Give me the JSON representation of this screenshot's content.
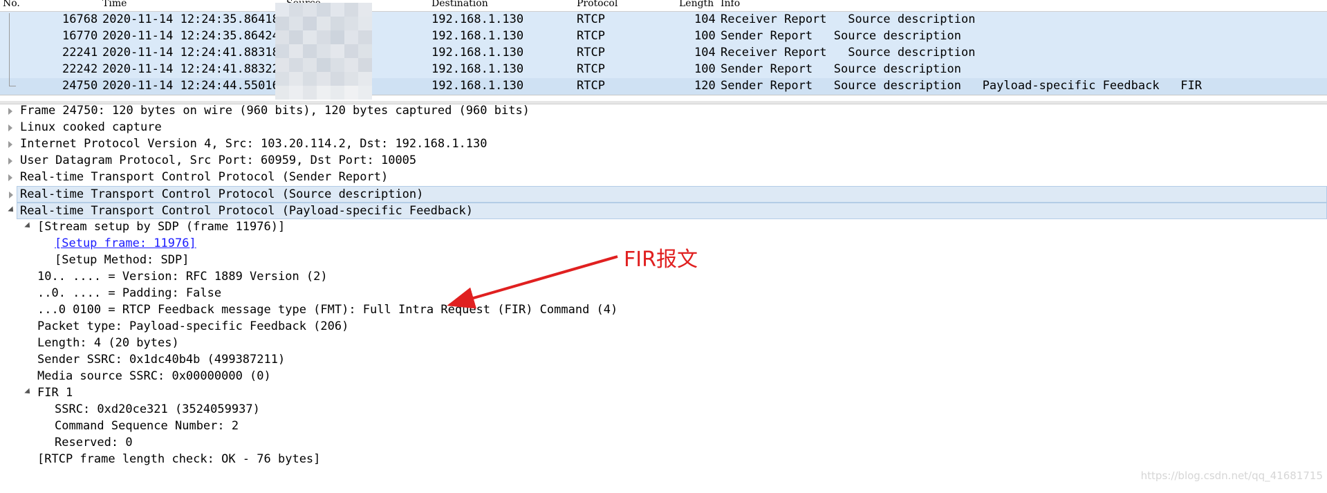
{
  "packet_list": {
    "columns": {
      "no": "No.",
      "time": "Time",
      "source": "Source",
      "destination": "Destination",
      "protocol": "Protocol",
      "length": "Length",
      "info": "Info"
    },
    "rows": [
      {
        "no": "16768",
        "time": "2020-11-14 12:24:35.86418",
        "destination": "192.168.1.130",
        "protocol": "RTCP",
        "length": "104",
        "info": "Receiver Report   Source description"
      },
      {
        "no": "16770",
        "time": "2020-11-14 12:24:35.86424",
        "destination": "192.168.1.130",
        "protocol": "RTCP",
        "length": "100",
        "info": "Sender Report   Source description"
      },
      {
        "no": "22241",
        "time": "2020-11-14 12:24:41.88318",
        "destination": "192.168.1.130",
        "protocol": "RTCP",
        "length": "104",
        "info": "Receiver Report   Source description"
      },
      {
        "no": "22242",
        "time": "2020-11-14 12:24:41.88322",
        "destination": "192.168.1.130",
        "protocol": "RTCP",
        "length": "100",
        "info": "Sender Report   Source description"
      },
      {
        "no": "24750",
        "time": "2020-11-14 12:24:44.55016",
        "destination": "192.168.1.130",
        "protocol": "RTCP",
        "length": "120",
        "info": "Sender Report   Source description   Payload-specific Feedback   FIR"
      }
    ]
  },
  "details": {
    "frame": "Frame 24750: 120 bytes on wire (960 bits), 120 bytes captured (960 bits)",
    "linux": "Linux cooked capture",
    "ip": "Internet Protocol Version 4, Src: 103.20.114.2, Dst: 192.168.1.130",
    "udp": "User Datagram Protocol, Src Port: 60959, Dst Port: 10005",
    "rtcp_sr": "Real-time Transport Control Protocol (Sender Report)",
    "rtcp_sd": "Real-time Transport Control Protocol (Source description)",
    "rtcp_psfb": "Real-time Transport Control Protocol (Payload-specific Feedback)",
    "stream_setup": "[Stream setup by SDP (frame 11976)]",
    "setup_frame": "[Setup frame: 11976]",
    "setup_method": "[Setup Method: SDP]",
    "version": "10.. .... = Version: RFC 1889 Version (2)",
    "padding": "..0. .... = Padding: False",
    "fmt": "...0 0100 = RTCP Feedback message type (FMT): Full Intra Request (FIR) Command (4)",
    "ptype": "Packet type: Payload-specific Feedback (206)",
    "length": "Length: 4 (20 bytes)",
    "sender_ssrc": "Sender SSRC: 0x1dc40b4b (499387211)",
    "media_ssrc": "Media source SSRC: 0x00000000 (0)",
    "fir": "FIR 1",
    "fir_ssrc": "SSRC: 0xd20ce321 (3524059937)",
    "seq": "Command Sequence Number: 2",
    "reserved": "Reserved: 0",
    "check": "[RTCP frame length check: OK - 76 bytes]"
  },
  "annotation": {
    "label": "FIR报文",
    "color": "#e02020"
  },
  "watermark": "https://blog.csdn.net/qq_41681715",
  "icons": {
    "collapsed": "triangle-right-icon",
    "expanded": "triangle-down-icon",
    "arrow": "red-arrow-icon"
  }
}
